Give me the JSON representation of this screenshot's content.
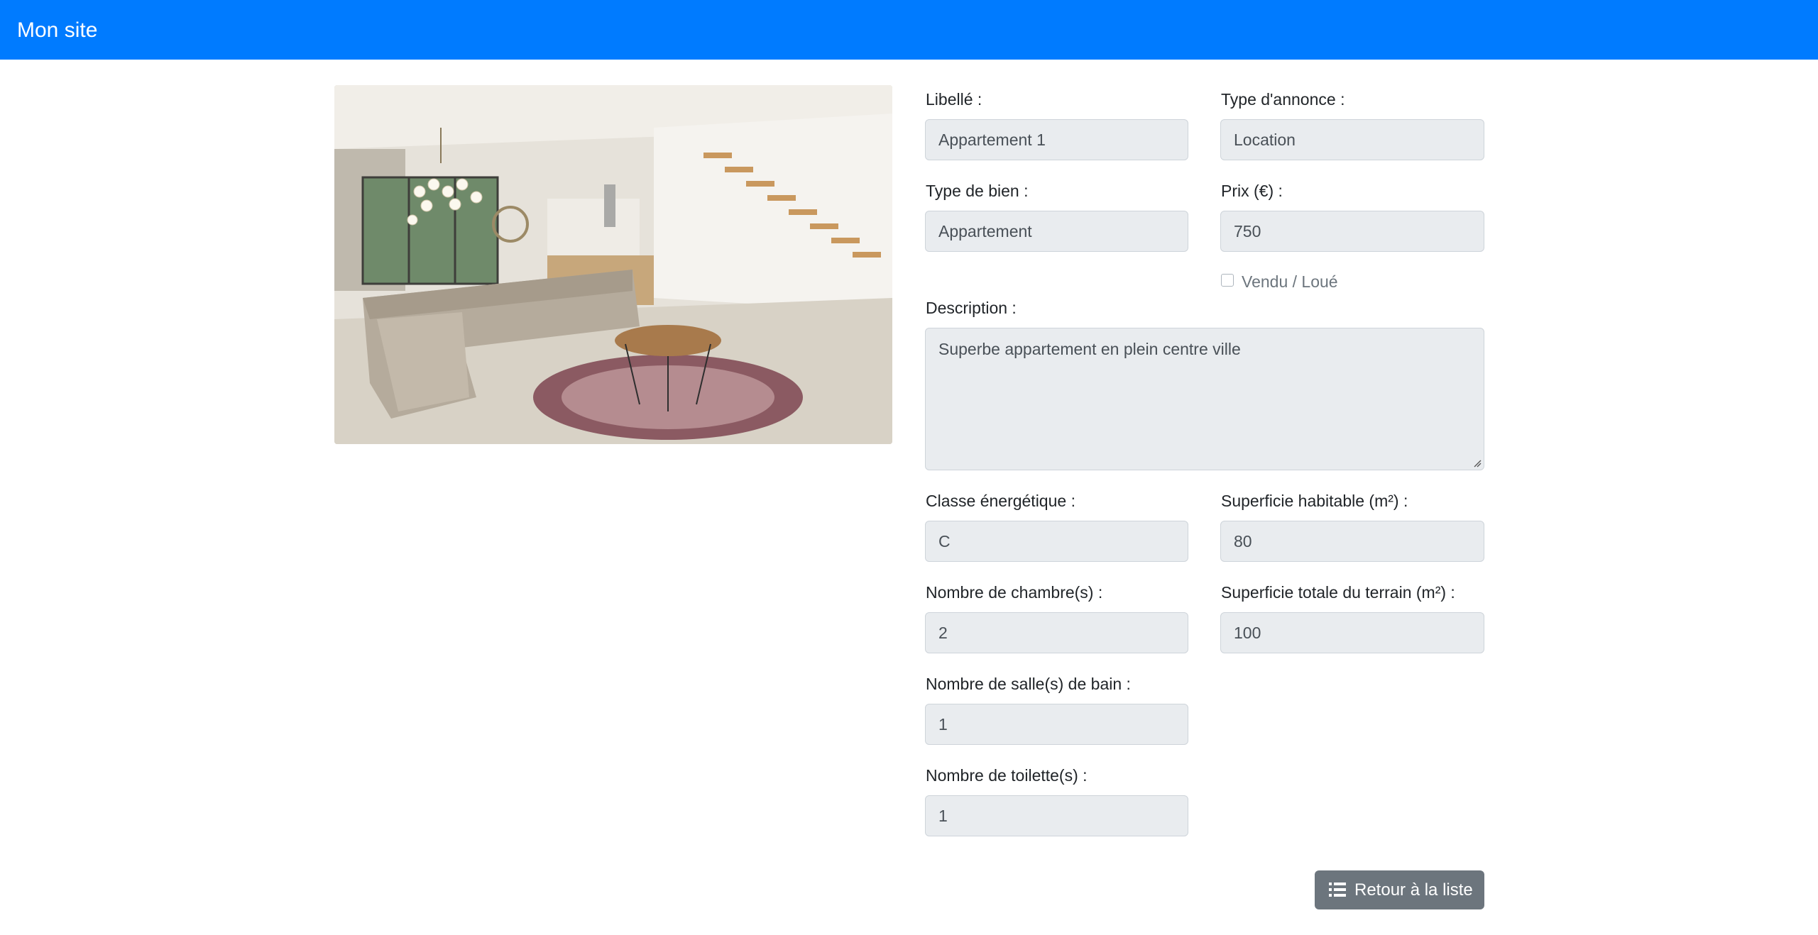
{
  "navbar": {
    "brand": "Mon site"
  },
  "image": {
    "alt": "Salon appartement"
  },
  "form": {
    "libelle": {
      "label": "Libellé :",
      "value": "Appartement 1"
    },
    "type_annonce": {
      "label": "Type d'annonce :",
      "value": "Location"
    },
    "type_bien": {
      "label": "Type de bien :",
      "value": "Appartement"
    },
    "prix": {
      "label": "Prix (€) :",
      "value": "750"
    },
    "vendu": {
      "label": "Vendu / Loué",
      "checked": false
    },
    "description": {
      "label": "Description :",
      "value": "Superbe appartement en plein centre ville"
    },
    "classe": {
      "label": "Classe énergétique :",
      "value": "C"
    },
    "superficie_habitable": {
      "label": "Superficie habitable (m²) :",
      "value": "80"
    },
    "chambres": {
      "label": "Nombre de chambre(s) :",
      "value": "2"
    },
    "superficie_terrain": {
      "label": "Superficie totale du terrain (m²) :",
      "value": "100"
    },
    "salles_bain": {
      "label": "Nombre de salle(s) de bain :",
      "value": "1"
    },
    "toilettes": {
      "label": "Nombre de toilette(s) :",
      "value": "1"
    }
  },
  "actions": {
    "back_label": "Retour à la liste"
  },
  "colors": {
    "navbar": "#007bff",
    "input_bg": "#e9ecef",
    "button": "#6c757d"
  }
}
